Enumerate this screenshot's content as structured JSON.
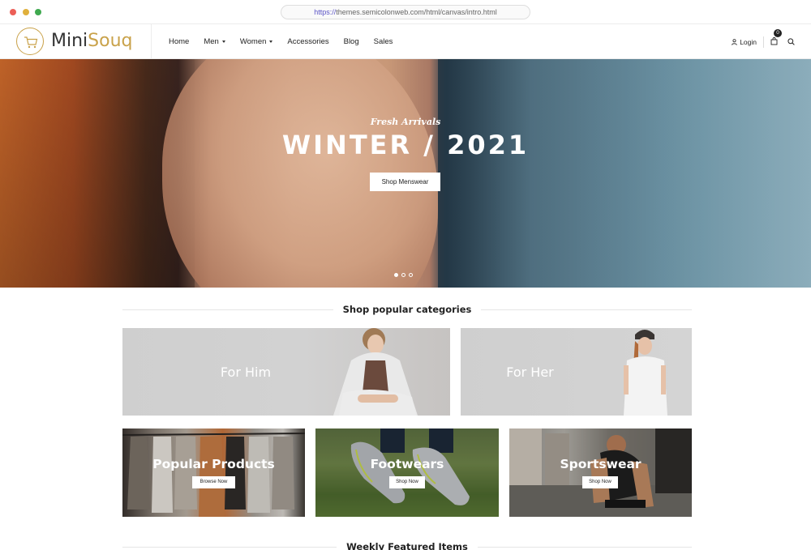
{
  "browser": {
    "url_scheme": "https://",
    "url_rest": "themes.semicolonweb.com/html/canvas/intro.html"
  },
  "header": {
    "logo_primary": "Mini",
    "logo_accent": "Souq",
    "nav": [
      {
        "label": "Home",
        "has_caret": false
      },
      {
        "label": "Men",
        "has_caret": true
      },
      {
        "label": "Women",
        "has_caret": true
      },
      {
        "label": "Accessories",
        "has_caret": false
      },
      {
        "label": "Blog",
        "has_caret": false
      },
      {
        "label": "Sales",
        "has_caret": false
      }
    ],
    "login_label": "Login",
    "cart_count": "0"
  },
  "hero": {
    "subtitle": "Fresh Arrivals",
    "title": "WINTER / 2021",
    "button_label": "Shop Menswear",
    "slides_total": 3,
    "active_slide": 1
  },
  "categories": {
    "heading": "Shop popular categories",
    "large": [
      {
        "label": "For Him"
      },
      {
        "label": "For Her"
      }
    ],
    "small": [
      {
        "label": "Popular Products",
        "button": "Browse Now"
      },
      {
        "label": "Footwears",
        "button": "Shop Now"
      },
      {
        "label": "Sportswear",
        "button": "Shop Now"
      }
    ]
  },
  "featured": {
    "heading": "Weekly Featured Items"
  },
  "colors": {
    "brand_gold": "#c9a24a",
    "text_dark": "#222222",
    "tile_gray": "#cfcfcf"
  }
}
